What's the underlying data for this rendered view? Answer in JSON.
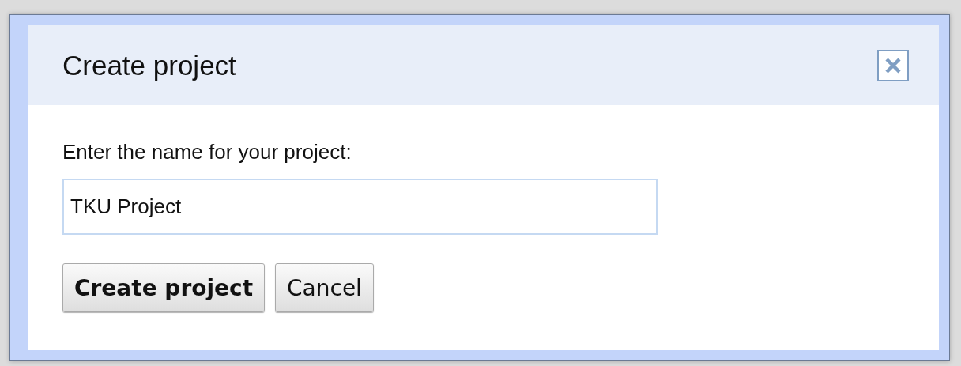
{
  "dialog": {
    "title": "Create project",
    "prompt": "Enter the name for your project:",
    "name_field": {
      "value": "TKU Project"
    },
    "buttons": [
      {
        "label": "Create project",
        "primary": true
      },
      {
        "label": "Cancel",
        "primary": false
      }
    ]
  }
}
